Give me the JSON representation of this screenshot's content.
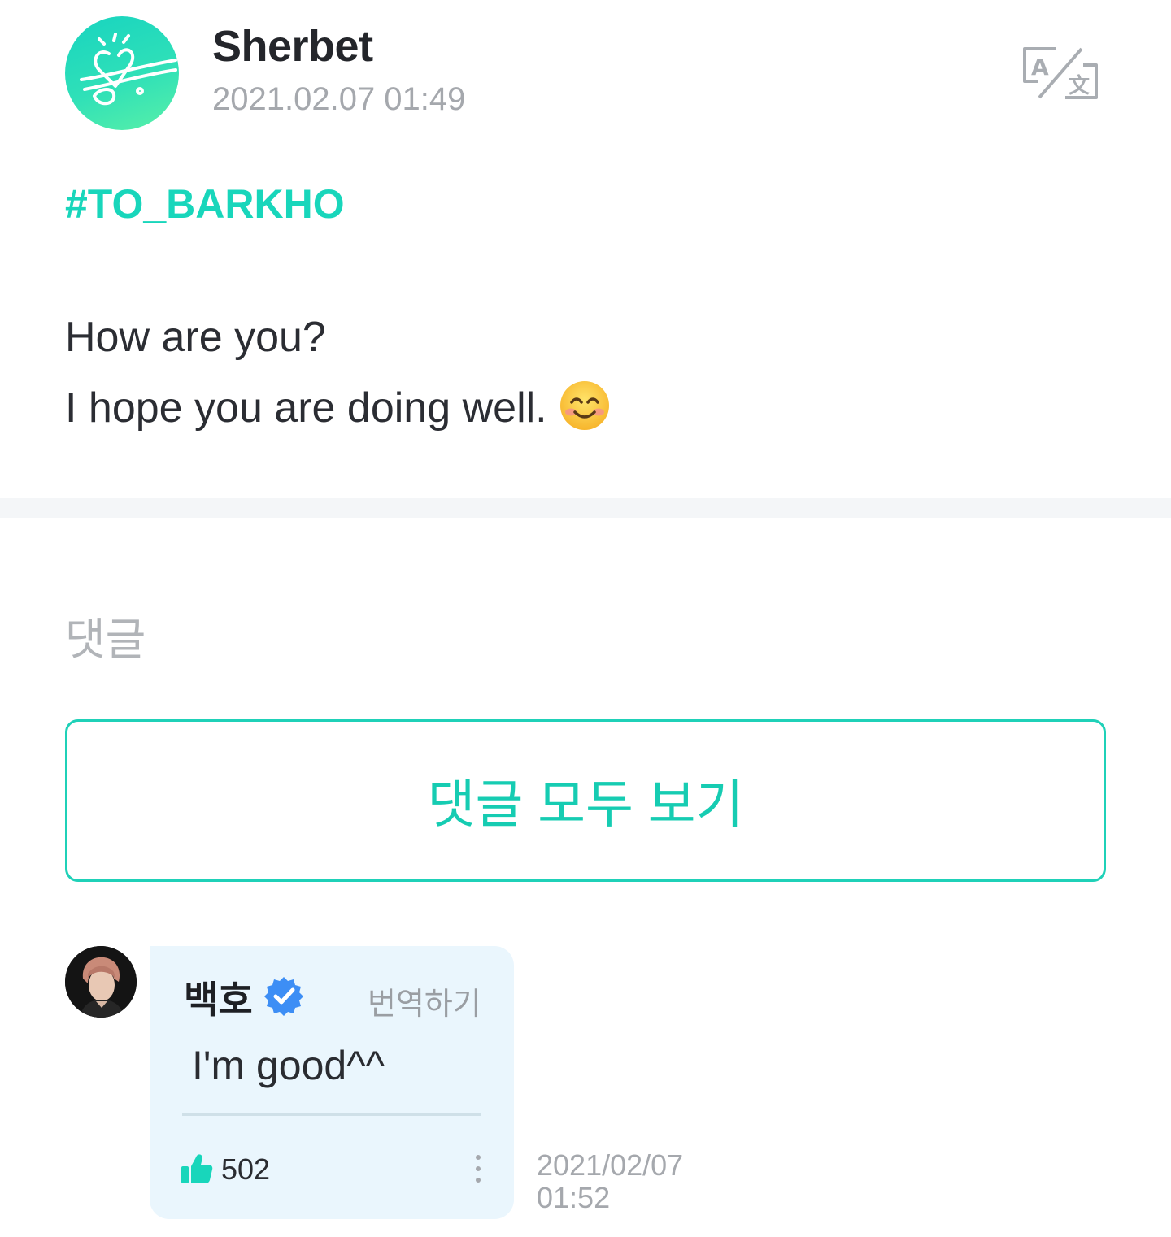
{
  "post": {
    "author": "Sherbet",
    "timestamp": "2021.02.07 01:49",
    "avatar_icon": "sherbet-logo-icon",
    "translate_icon": "translate-icon",
    "hashtag": "#TO_BARKHO",
    "body_line_1": "How are you?",
    "body_line_2": "I hope you are doing well.",
    "emoji_icon": "smiling-face-icon"
  },
  "comments": {
    "section_title": "댓글",
    "view_all_label": "댓글 모두 보기",
    "items": [
      {
        "author": "백호",
        "verified_icon": "verified-badge-icon",
        "translate_label": "번역하기",
        "text": "I'm good^^",
        "like_icon": "thumbs-up-icon",
        "likes": "502",
        "more_icon": "more-vertical-icon",
        "date": "2021/02/07",
        "time": "01:52"
      }
    ]
  },
  "colors": {
    "accent": "#18d6bb",
    "card_background": "#eaf6fd",
    "verified": "#3d8ef5",
    "muted_text": "#a5a8ad"
  }
}
